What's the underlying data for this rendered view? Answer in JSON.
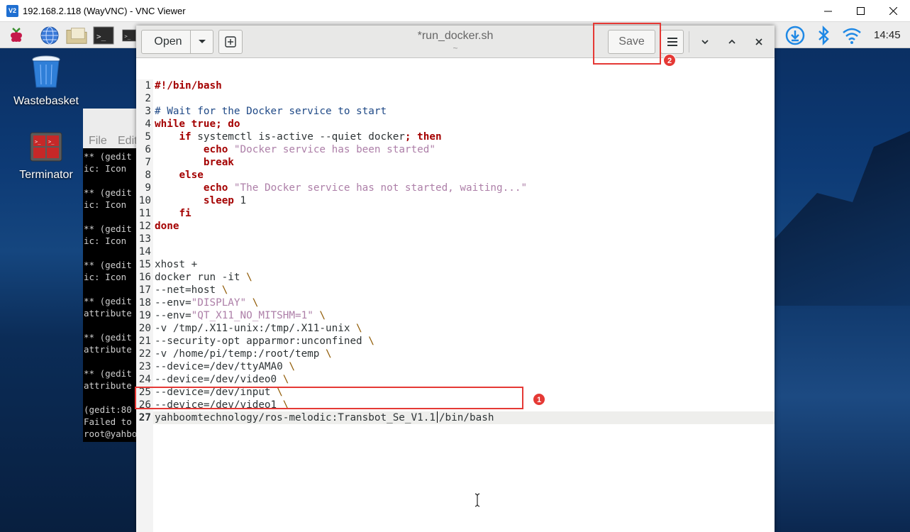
{
  "vnc": {
    "icon_text": "V2",
    "title": "192.168.2.118 (WayVNC) - VNC Viewer"
  },
  "panel": {
    "clock": "14:45",
    "launchers": [
      "raspberry-icon",
      "globe-icon",
      "folder-icon",
      "terminal-icon",
      "terminal-icon"
    ],
    "tray": [
      "download-icon",
      "bluetooth-icon",
      "wifi-icon"
    ]
  },
  "desktop": {
    "icons": [
      {
        "label": "Wastebasket",
        "icon": "wastebasket-icon"
      },
      {
        "label": "Terminator",
        "icon": "terminator-icon"
      }
    ]
  },
  "terminal": {
    "menu": [
      "File",
      "Edit"
    ],
    "lines": [
      "** (gedit",
      "ic: Icon",
      "",
      "** (gedit",
      "ic: Icon",
      "",
      "** (gedit",
      "ic: Icon",
      "",
      "** (gedit",
      "ic: Icon",
      "",
      "** (gedit",
      "attribute",
      "",
      "** (gedit",
      "attribute",
      "",
      "** (gedit",
      "attribute",
      "",
      "(gedit:80",
      "Failed to",
      "root@yahbo"
    ]
  },
  "gedit": {
    "open_label": "Open",
    "doc_title": "*run_docker.sh",
    "doc_subtitle": "~",
    "save_label": "Save",
    "current_line": 27,
    "lines": [
      [
        [
          "kw",
          "#!/bin/bash"
        ]
      ],
      [],
      [
        [
          "cm",
          "# Wait for the Docker service to start"
        ]
      ],
      [
        [
          "kw",
          "while true; do"
        ]
      ],
      [
        [
          "",
          "    "
        ],
        [
          "kw",
          "if"
        ],
        [
          "",
          " systemctl is-active --quiet docker"
        ],
        [
          "kw",
          "; then"
        ]
      ],
      [
        [
          "",
          "        "
        ],
        [
          "kw",
          "echo"
        ],
        [
          "",
          " "
        ],
        [
          "st",
          "\"Docker service has been started\""
        ]
      ],
      [
        [
          "",
          "        "
        ],
        [
          "kw",
          "break"
        ]
      ],
      [
        [
          "",
          "    "
        ],
        [
          "kw",
          "else"
        ]
      ],
      [
        [
          "",
          "        "
        ],
        [
          "kw",
          "echo"
        ],
        [
          "",
          " "
        ],
        [
          "st",
          "\"The Docker service has not started, waiting...\""
        ]
      ],
      [
        [
          "",
          "        "
        ],
        [
          "kw",
          "sleep"
        ],
        [
          "",
          " 1"
        ]
      ],
      [
        [
          "",
          "    "
        ],
        [
          "kw",
          "fi"
        ]
      ],
      [
        [
          "kw",
          "done"
        ]
      ],
      [],
      [],
      [
        [
          "",
          "xhost +"
        ]
      ],
      [
        [
          "",
          "docker run -it "
        ],
        [
          "bs",
          "\\"
        ]
      ],
      [
        [
          "",
          "--net=host "
        ],
        [
          "bs",
          "\\"
        ]
      ],
      [
        [
          "",
          "--env="
        ],
        [
          "st",
          "\"DISPLAY\""
        ],
        [
          "",
          " "
        ],
        [
          "bs",
          "\\"
        ]
      ],
      [
        [
          "",
          "--env="
        ],
        [
          "st",
          "\"QT_X11_NO_MITSHM=1\""
        ],
        [
          "",
          " "
        ],
        [
          "bs",
          "\\"
        ]
      ],
      [
        [
          "",
          "-v /tmp/.X11-unix:/tmp/.X11-unix "
        ],
        [
          "bs",
          "\\"
        ]
      ],
      [
        [
          "",
          "--security-opt apparmor:unconfined "
        ],
        [
          "bs",
          "\\"
        ]
      ],
      [
        [
          "",
          "-v /home/pi/temp:/root/temp "
        ],
        [
          "bs",
          "\\"
        ]
      ],
      [
        [
          "",
          "--device=/dev/ttyAMA0 "
        ],
        [
          "bs",
          "\\"
        ]
      ],
      [
        [
          "",
          "--device=/dev/video0 "
        ],
        [
          "bs",
          "\\"
        ]
      ],
      [
        [
          "",
          "--device=/dev/input "
        ],
        [
          "bs",
          "\\"
        ]
      ],
      [
        [
          "",
          "--device=/dev/video1 "
        ],
        [
          "bs",
          "\\"
        ]
      ],
      [
        [
          "",
          "yahboomtechnology/ros-melodic:Transbot_Se_V1.1"
        ],
        [
          "cursor",
          ""
        ],
        [
          "",
          "/bin/bash"
        ]
      ]
    ]
  },
  "annotations": [
    {
      "number": "1",
      "target": "line 27"
    },
    {
      "number": "2",
      "target": "Save button"
    }
  ]
}
